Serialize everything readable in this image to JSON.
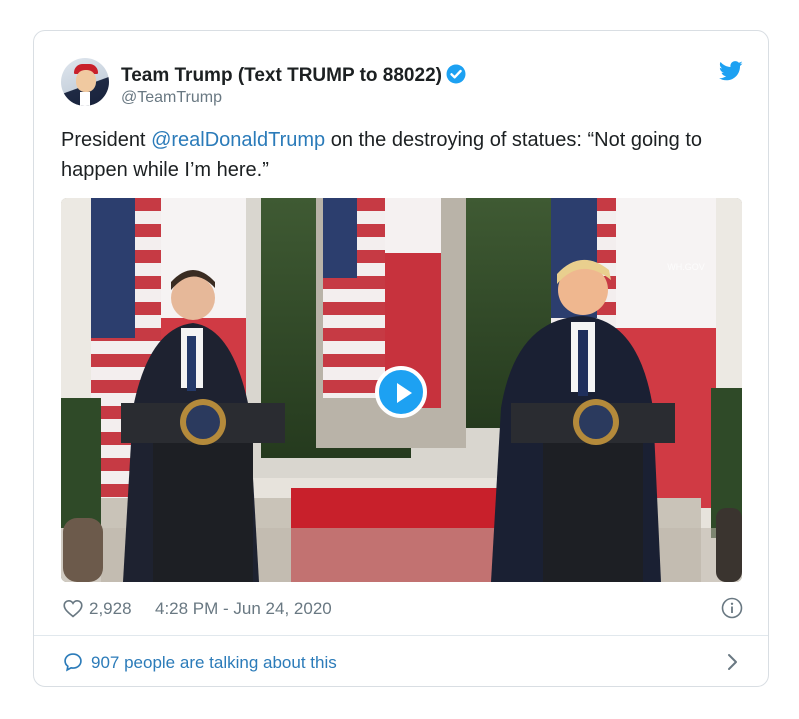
{
  "tweet": {
    "author_name": "Team Trump (Text TRUMP to 88022)",
    "handle": "@TeamTrump",
    "text_before": "President ",
    "mention": "@realDonaldTrump",
    "text_after": " on the destroying of statues: “Not going to happen while I’m here.”",
    "likes": "2,928",
    "timestamp": "4:28 PM - Jun 24, 2020",
    "talking": "907 people are talking about this",
    "watermark": "WH.GOV"
  },
  "colors": {
    "link": "#2b7bb9",
    "twitter_blue": "#1da1f2",
    "secondary_text": "#697882",
    "primary_text": "#1c2022",
    "border": "#e1e8ed"
  },
  "icons": [
    "verified-badge-icon",
    "twitter-bird-icon",
    "play-icon",
    "heart-icon",
    "info-icon",
    "speech-bubble-icon",
    "chevron-right-icon"
  ]
}
